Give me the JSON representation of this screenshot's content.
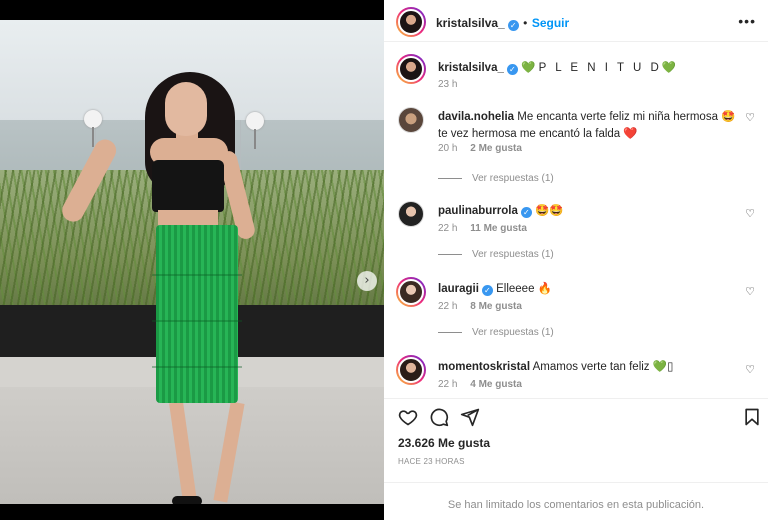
{
  "post": {
    "username": "kristalsilva_",
    "follow_label": "Seguir",
    "dot": "•",
    "more_label": "•••",
    "carousel_next": "›"
  },
  "caption": {
    "username": "kristalsilva_",
    "text": "P L E N I T U D",
    "emoji_before": "💚",
    "emoji_after": "💚",
    "time": "23 h"
  },
  "comments": [
    {
      "username": "davila.nohelia",
      "text": "Me encanta verte feliz mi niña hermosa",
      "emoji1": "🤩",
      "text2": "te vez hermosa me encantó la falda",
      "emoji2": "❤️",
      "time": "20 h",
      "likes": "2 Me gusta",
      "replies": "Ver respuestas (1)",
      "verified": false
    },
    {
      "username": "paulinaburrola",
      "text": "",
      "emoji1": "🤩🤩",
      "time": "22 h",
      "likes": "11 Me gusta",
      "replies": "Ver respuestas (1)",
      "verified": true
    },
    {
      "username": "lauragii",
      "text": "Elleeee",
      "emoji1": "🔥",
      "time": "22 h",
      "likes": "8 Me gusta",
      "replies": "Ver respuestas (1)",
      "verified": true
    },
    {
      "username": "momentoskristal",
      "text": "Amamos verte tan feliz",
      "emoji1": "💚",
      "emoji_tail": "▯",
      "time": "22 h",
      "likes": "4 Me gusta",
      "verified": false
    }
  ],
  "footer": {
    "likes_total": "23.626 Me gusta",
    "time_ago": "HACE 23 HORAS",
    "limited_notice": "Se han limitado los comentarios en esta publicación."
  },
  "icons": [
    "heart-icon",
    "comment-icon",
    "share-icon",
    "bookmark-icon",
    "verified-icon",
    "more-icon",
    "chevron-right-icon"
  ],
  "colors": {
    "link": "#0095f6",
    "verified": "#3897f0",
    "muted": "#8e8e8e",
    "text": "#262626"
  }
}
